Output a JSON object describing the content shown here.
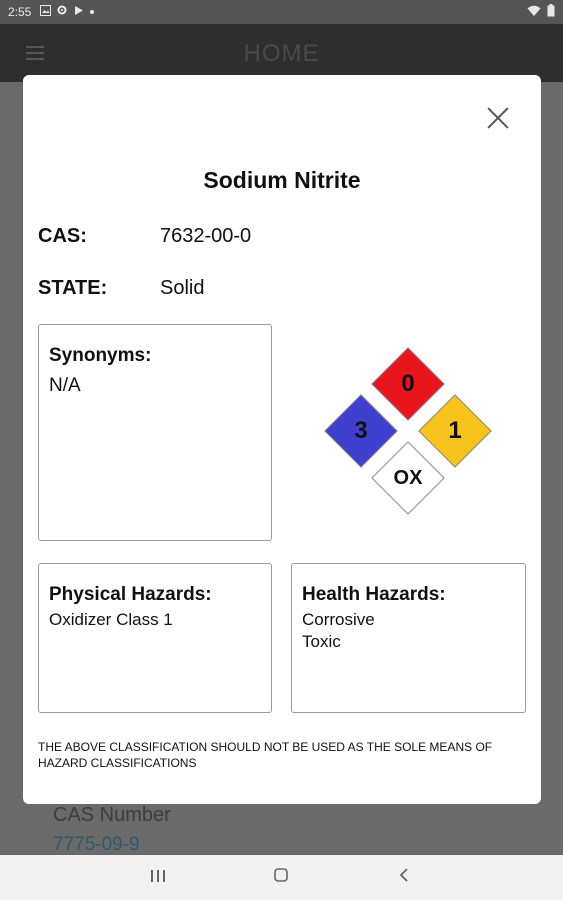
{
  "status_bar": {
    "time": "2:55",
    "icons": [
      "image-icon",
      "settings-icon",
      "play-icon",
      "dot-icon"
    ],
    "right_icons": [
      "wifi-icon",
      "battery-icon"
    ]
  },
  "app_bar": {
    "title": "HOME"
  },
  "background": {
    "field_label": "CAS Number",
    "field_value": "7775-09-9"
  },
  "dialog": {
    "chemical_name": "Sodium Nitrite",
    "cas_label": "CAS:",
    "cas_value": "7632-00-0",
    "state_label": "STATE:",
    "state_value": "Solid",
    "synonyms_title": "Synonyms:",
    "synonyms_value": "N/A",
    "nfpa": {
      "flammability": "0",
      "health": "3",
      "instability": "1",
      "special": "OX",
      "colors": {
        "flammability": "#e8141b",
        "health": "#3f3fd0",
        "instability": "#f7c21c",
        "special": "#ffffff"
      }
    },
    "physical_title": "Physical Hazards:",
    "physical_items": [
      "Oxidizer Class 1"
    ],
    "health_title": "Health Hazards:",
    "health_items": [
      "Corrosive",
      "Toxic"
    ],
    "disclaimer": "THE ABOVE CLASSIFICATION SHOULD NOT BE USED AS THE SOLE MEANS OF HAZARD CLASSIFICATIONS"
  },
  "nav_bar": {
    "recents": "|||",
    "home": "○",
    "back": "‹"
  }
}
